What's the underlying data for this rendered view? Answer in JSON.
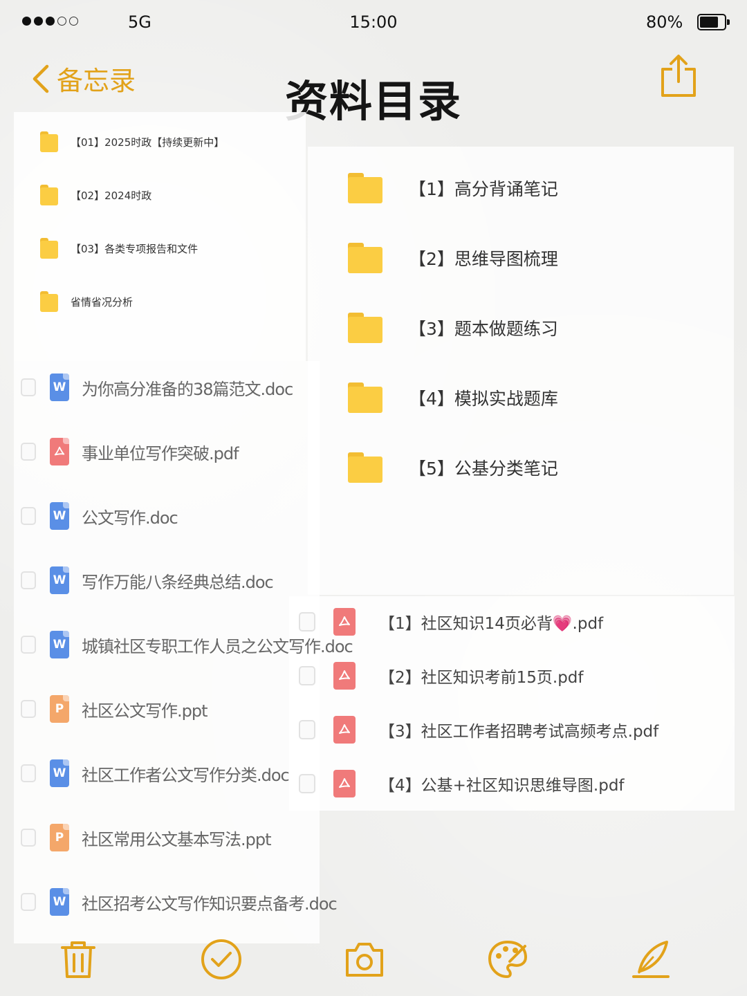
{
  "status_bar": {
    "signal_dots": [
      true,
      true,
      true,
      false,
      false
    ],
    "carrier": "5G",
    "time": "15:00",
    "battery_text": "80%",
    "battery_level": 0.8
  },
  "nav": {
    "back_label": "备忘录",
    "title": "资料目录",
    "accent_color": "#e2a21a",
    "share_icon": "share-icon"
  },
  "top_left_folders": [
    {
      "label": "【01】2025时政【持续更新中】"
    },
    {
      "label": "【02】2024时政"
    },
    {
      "label": "【03】各类专项报告和文件"
    },
    {
      "label": "省情省况分析"
    }
  ],
  "right_folders": [
    {
      "label": "【1】高分背诵笔记"
    },
    {
      "label": "【2】思维导图梳理"
    },
    {
      "label": "【3】题本做题练习"
    },
    {
      "label": "【4】模拟实战题库"
    },
    {
      "label": "【5】公基分类笔记"
    }
  ],
  "files": [
    {
      "label": "为你高分准备的38篇范文.doc",
      "type": "W",
      "color": "#5a8fe6"
    },
    {
      "label": "事业单位写作突破.pdf",
      "type": "pdf",
      "color": "#f07a7a"
    },
    {
      "label": "公文写作.doc",
      "type": "W",
      "color": "#5a8fe6"
    },
    {
      "label": "写作万能八条经典总结.doc",
      "type": "W",
      "color": "#5a8fe6"
    },
    {
      "label": "城镇社区专职工作人员之公文写作.doc",
      "type": "W",
      "color": "#5a8fe6"
    },
    {
      "label": "社区公文写作.ppt",
      "type": "P",
      "color": "#f4a76a"
    },
    {
      "label": "社区工作者公文写作分类.doc",
      "type": "W",
      "color": "#5a8fe6"
    },
    {
      "label": "社区常用公文基本写法.ppt",
      "type": "P",
      "color": "#f4a76a"
    },
    {
      "label": "社区招考公文写作知识要点备考.doc",
      "type": "W",
      "color": "#5a8fe6"
    }
  ],
  "pdf_files": [
    {
      "label": "【1】社区知识14页必背💗.pdf"
    },
    {
      "label": "【2】社区知识考前15页.pdf"
    },
    {
      "label": "【3】社区工作者招聘考试高频考点.pdf"
    },
    {
      "label": "【4】公基+社区知识思维导图.pdf"
    }
  ],
  "toolbar": [
    {
      "icon": "trash-icon"
    },
    {
      "icon": "checkmark-circle-icon"
    },
    {
      "icon": "camera-icon"
    },
    {
      "icon": "palette-icon"
    },
    {
      "icon": "pen-icon"
    }
  ]
}
